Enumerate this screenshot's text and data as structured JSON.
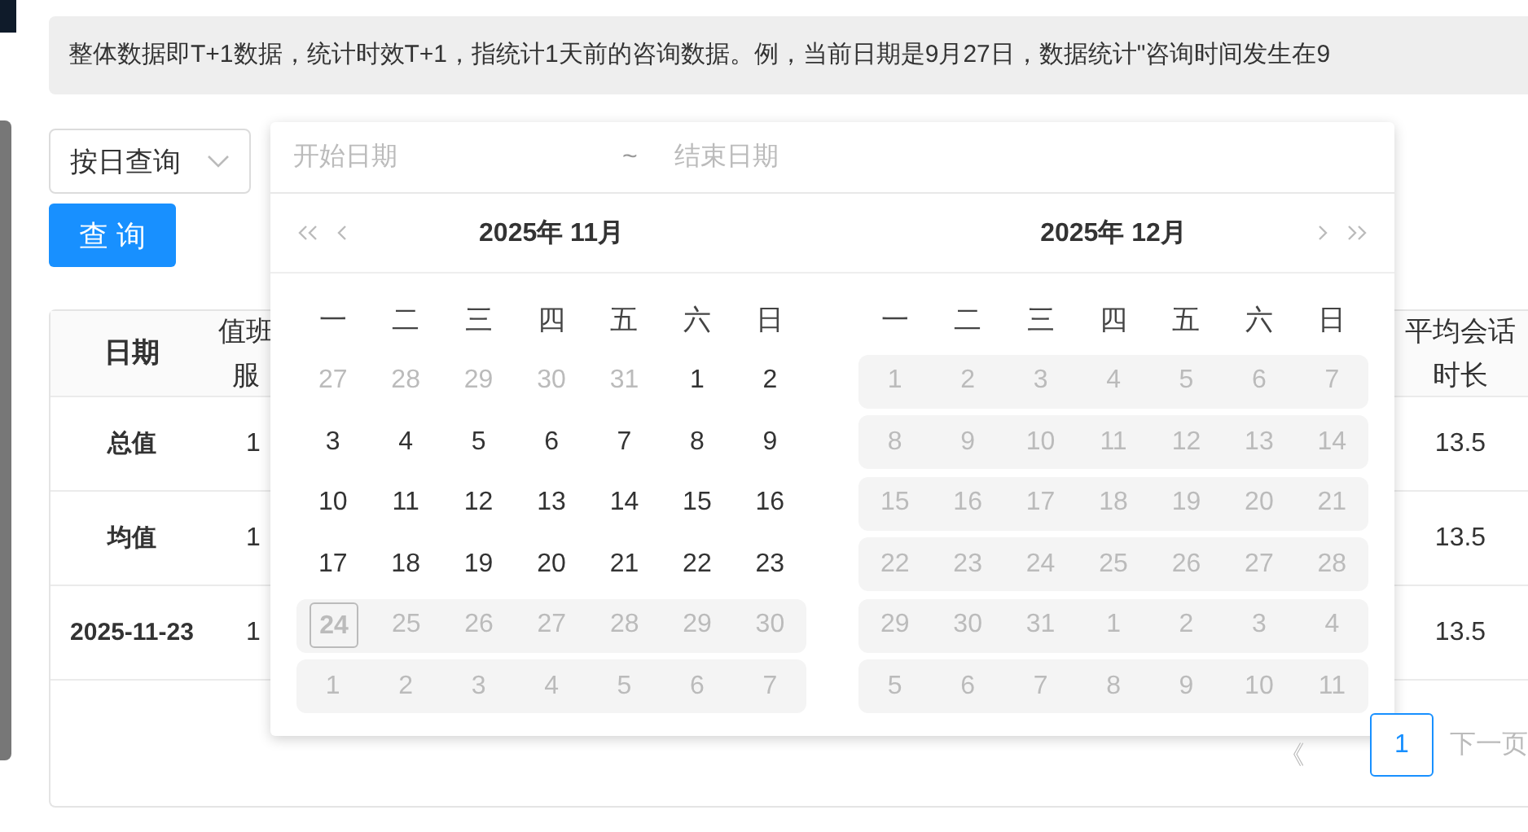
{
  "notice": "整体数据即T+1数据，统计时效T+1，指统计1天前的咨询数据。例，当前日期是9月27日，数据统计\"咨询时间发生在9",
  "filter": {
    "mode": "按日查询",
    "start_placeholder": "开始日期",
    "separator": "~",
    "end_placeholder": "结束日期",
    "query_button": "查 询"
  },
  "table": {
    "columns": [
      "日期",
      "值班服",
      "平均会话时长"
    ],
    "rows": [
      {
        "date": "总值",
        "column_2": "1",
        "avg": "13.5"
      },
      {
        "date": "均值",
        "column_2": "1",
        "avg": "13.5"
      },
      {
        "date": "2025-11-23",
        "column_2": "1",
        "avg": "13.5"
      }
    ]
  },
  "pagination": {
    "prev": "《",
    "pages": [
      {
        "label": "1",
        "selected": true
      }
    ],
    "next": "下一页"
  },
  "calendar": {
    "panels": [
      {
        "title": "2025年 11月",
        "kind": "left",
        "weekdays": [
          "一",
          "二",
          "三",
          "四",
          "五",
          "六",
          "日"
        ],
        "weeks": [
          [
            {
              "d": "27",
              "kind": "other"
            },
            {
              "d": "28",
              "kind": "other"
            },
            {
              "d": "29",
              "kind": "other"
            },
            {
              "d": "30",
              "kind": "other"
            },
            {
              "d": "31",
              "kind": "other"
            },
            {
              "d": "1",
              "kind": "normal"
            },
            {
              "d": "2",
              "kind": "normal"
            }
          ],
          [
            {
              "d": "3",
              "kind": "normal"
            },
            {
              "d": "4",
              "kind": "normal"
            },
            {
              "d": "5",
              "kind": "normal"
            },
            {
              "d": "6",
              "kind": "normal"
            },
            {
              "d": "7",
              "kind": "normal"
            },
            {
              "d": "8",
              "kind": "normal"
            },
            {
              "d": "9",
              "kind": "normal"
            }
          ],
          [
            {
              "d": "10",
              "kind": "normal"
            },
            {
              "d": "11",
              "kind": "normal"
            },
            {
              "d": "12",
              "kind": "normal"
            },
            {
              "d": "13",
              "kind": "normal"
            },
            {
              "d": "14",
              "kind": "normal"
            },
            {
              "d": "15",
              "kind": "normal"
            },
            {
              "d": "16",
              "kind": "normal"
            }
          ],
          [
            {
              "d": "17",
              "kind": "normal"
            },
            {
              "d": "18",
              "kind": "normal"
            },
            {
              "d": "19",
              "kind": "normal"
            },
            {
              "d": "20",
              "kind": "normal"
            },
            {
              "d": "21",
              "kind": "normal"
            },
            {
              "d": "22",
              "kind": "normal"
            },
            {
              "d": "23",
              "kind": "normal"
            }
          ],
          [
            {
              "d": "24",
              "kind": "today"
            },
            {
              "d": "25",
              "kind": "disabled"
            },
            {
              "d": "26",
              "kind": "disabled"
            },
            {
              "d": "27",
              "kind": "disabled"
            },
            {
              "d": "28",
              "kind": "disabled"
            },
            {
              "d": "29",
              "kind": "disabled"
            },
            {
              "d": "30",
              "kind": "disabled"
            }
          ],
          [
            {
              "d": "1",
              "kind": "disabled"
            },
            {
              "d": "2",
              "kind": "disabled"
            },
            {
              "d": "3",
              "kind": "disabled"
            },
            {
              "d": "4",
              "kind": "disabled"
            },
            {
              "d": "5",
              "kind": "disabled"
            },
            {
              "d": "6",
              "kind": "disabled"
            },
            {
              "d": "7",
              "kind": "disabled"
            }
          ]
        ]
      },
      {
        "title": "2025年 12月",
        "kind": "right",
        "weekdays": [
          "一",
          "二",
          "三",
          "四",
          "五",
          "六",
          "日"
        ],
        "weeks": [
          [
            {
              "d": "1",
              "kind": "disabled"
            },
            {
              "d": "2",
              "kind": "disabled"
            },
            {
              "d": "3",
              "kind": "disabled"
            },
            {
              "d": "4",
              "kind": "disabled"
            },
            {
              "d": "5",
              "kind": "disabled"
            },
            {
              "d": "6",
              "kind": "disabled"
            },
            {
              "d": "7",
              "kind": "disabled"
            }
          ],
          [
            {
              "d": "8",
              "kind": "disabled"
            },
            {
              "d": "9",
              "kind": "disabled"
            },
            {
              "d": "10",
              "kind": "disabled"
            },
            {
              "d": "11",
              "kind": "disabled"
            },
            {
              "d": "12",
              "kind": "disabled"
            },
            {
              "d": "13",
              "kind": "disabled"
            },
            {
              "d": "14",
              "kind": "disabled"
            }
          ],
          [
            {
              "d": "15",
              "kind": "disabled"
            },
            {
              "d": "16",
              "kind": "disabled"
            },
            {
              "d": "17",
              "kind": "disabled"
            },
            {
              "d": "18",
              "kind": "disabled"
            },
            {
              "d": "19",
              "kind": "disabled"
            },
            {
              "d": "20",
              "kind": "disabled"
            },
            {
              "d": "21",
              "kind": "disabled"
            }
          ],
          [
            {
              "d": "22",
              "kind": "disabled"
            },
            {
              "d": "23",
              "kind": "disabled"
            },
            {
              "d": "24",
              "kind": "disabled"
            },
            {
              "d": "25",
              "kind": "disabled"
            },
            {
              "d": "26",
              "kind": "disabled"
            },
            {
              "d": "27",
              "kind": "disabled"
            },
            {
              "d": "28",
              "kind": "disabled"
            }
          ],
          [
            {
              "d": "29",
              "kind": "disabled"
            },
            {
              "d": "30",
              "kind": "disabled"
            },
            {
              "d": "31",
              "kind": "disabled"
            },
            {
              "d": "1",
              "kind": "disabled"
            },
            {
              "d": "2",
              "kind": "disabled"
            },
            {
              "d": "3",
              "kind": "disabled"
            },
            {
              "d": "4",
              "kind": "disabled"
            }
          ],
          [
            {
              "d": "5",
              "kind": "disabled"
            },
            {
              "d": "6",
              "kind": "disabled"
            },
            {
              "d": "7",
              "kind": "disabled"
            },
            {
              "d": "8",
              "kind": "disabled"
            },
            {
              "d": "9",
              "kind": "disabled"
            },
            {
              "d": "10",
              "kind": "disabled"
            },
            {
              "d": "11",
              "kind": "disabled"
            }
          ]
        ]
      }
    ]
  }
}
